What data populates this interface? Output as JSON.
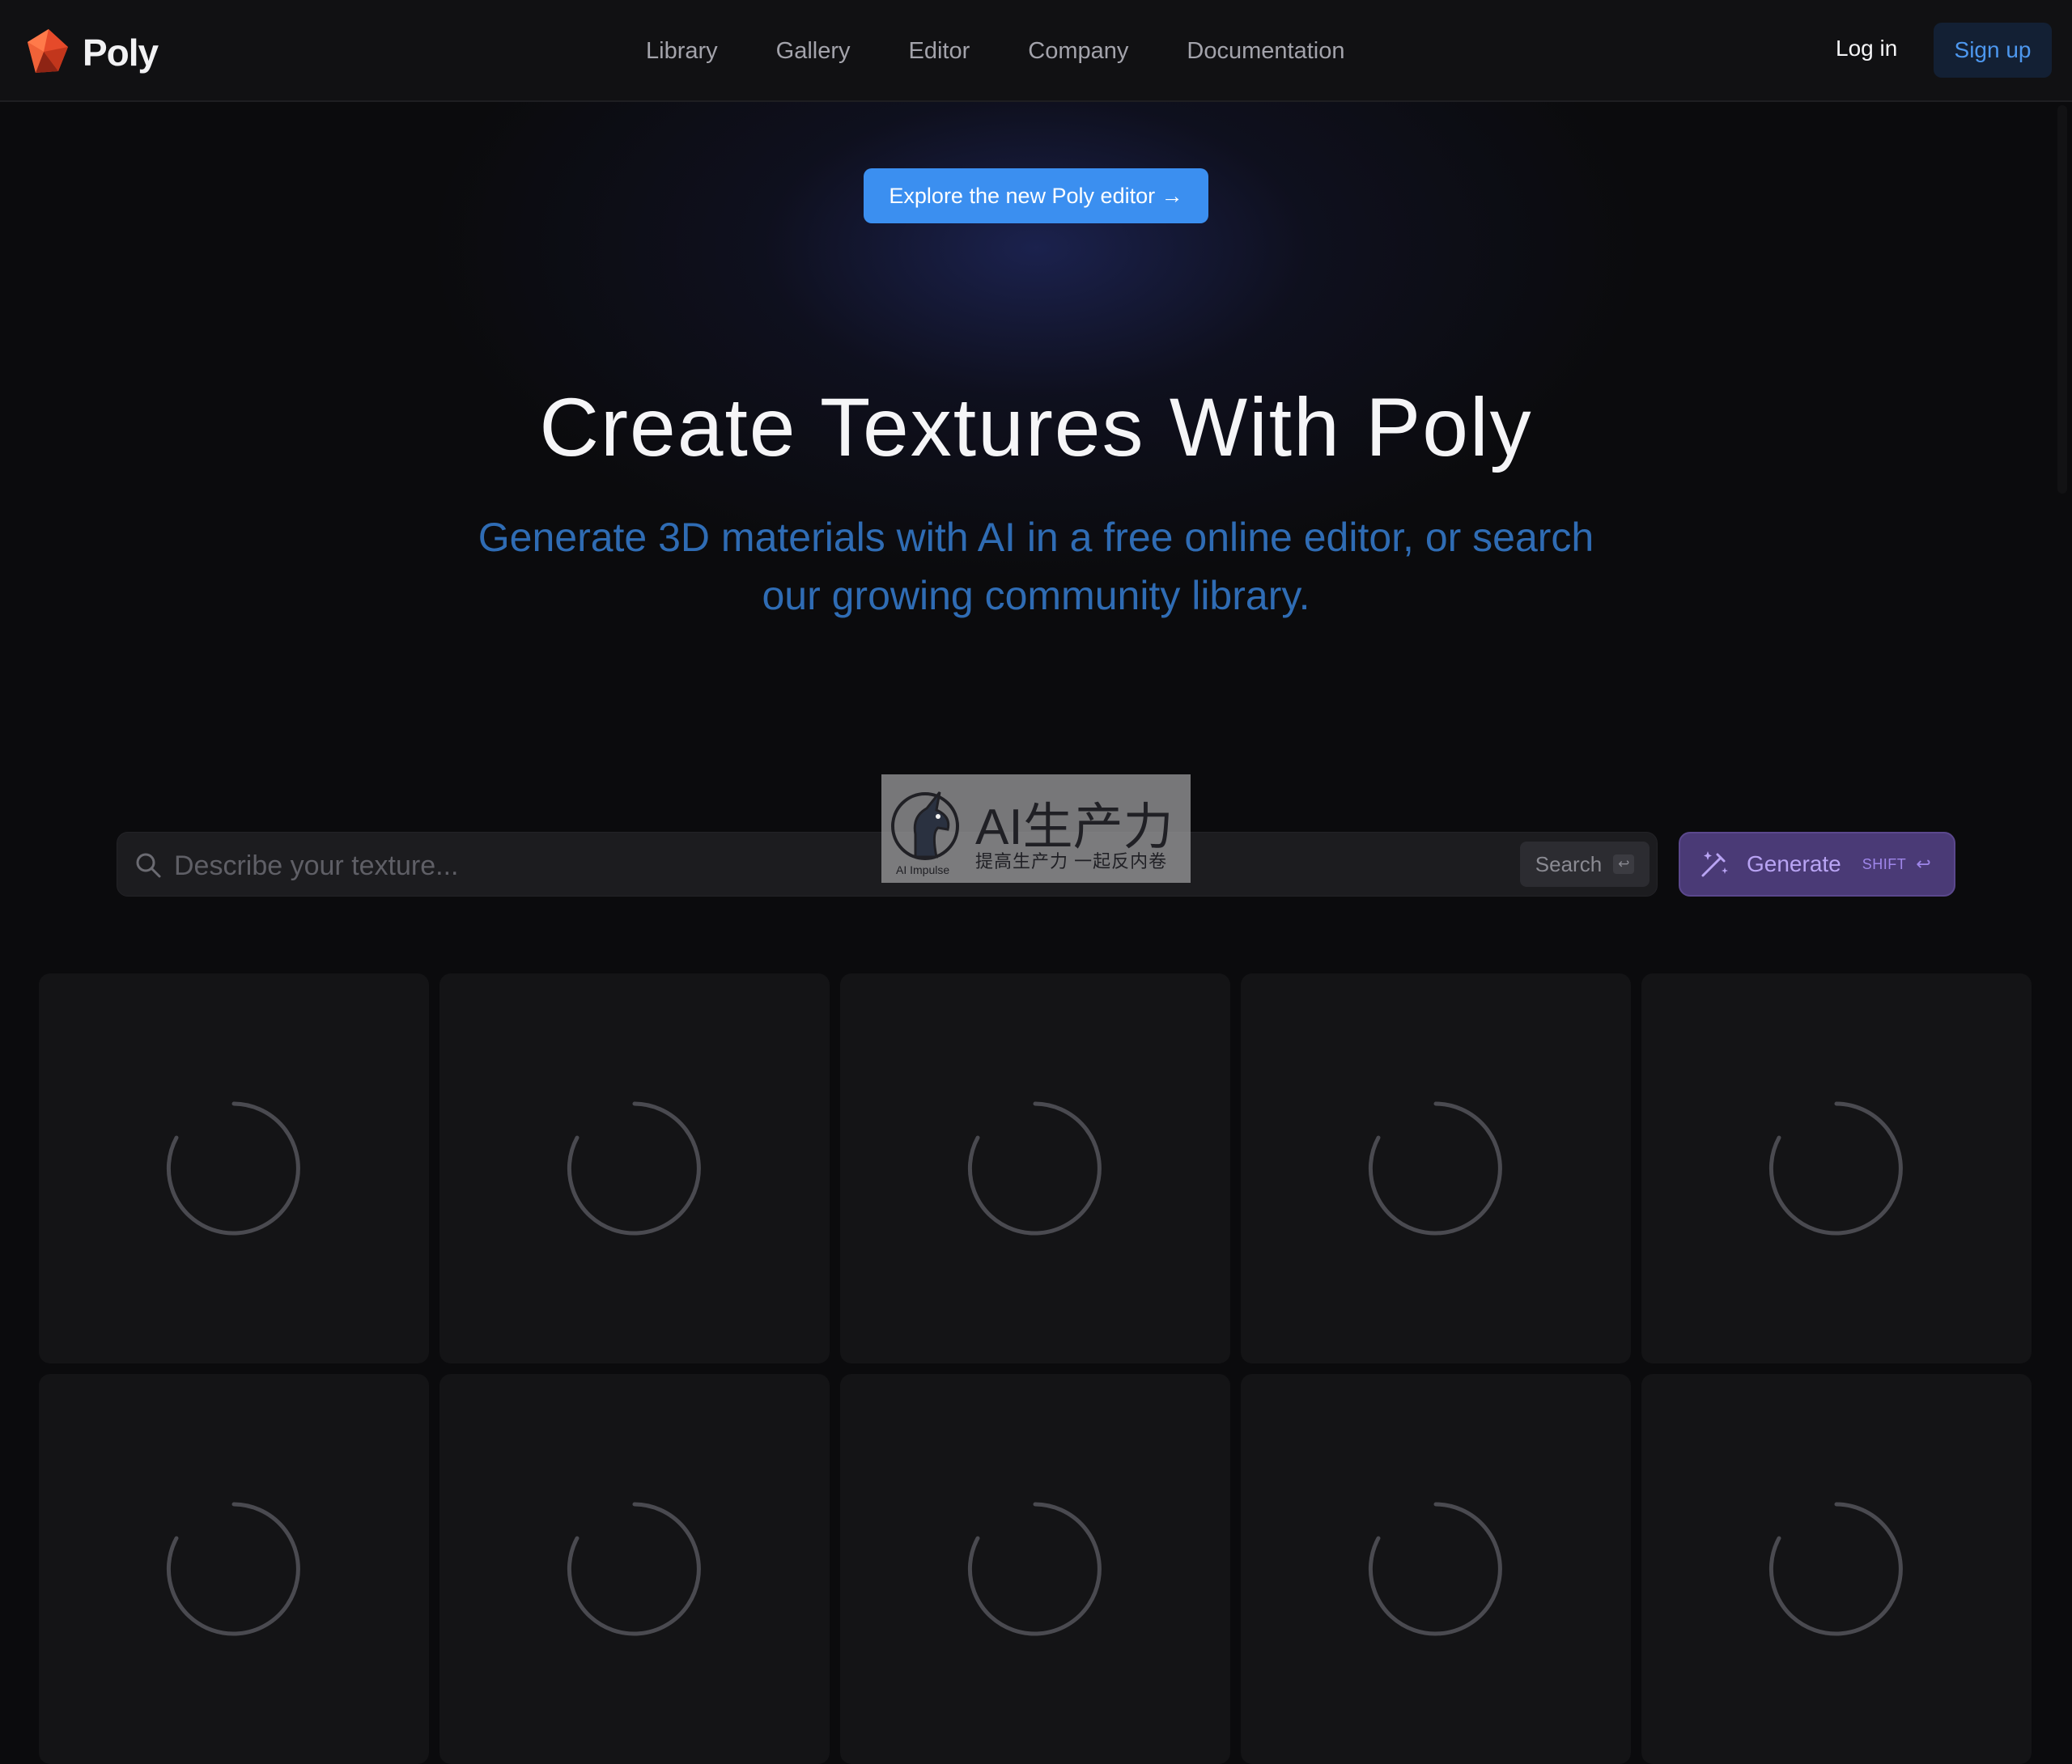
{
  "brand": {
    "name": "Poly"
  },
  "nav": [
    "Library",
    "Gallery",
    "Editor",
    "Company",
    "Documentation"
  ],
  "auth": {
    "login": "Log in",
    "signup": "Sign up"
  },
  "hero": {
    "cta": "Explore the new Poly editor →",
    "title": "Create Textures With Poly",
    "subtitle_line1": "Generate 3D materials with AI in a free online editor, or search",
    "subtitle_line2": "our growing community library."
  },
  "search": {
    "placeholder": "Describe your texture...",
    "value": "",
    "button": "Search",
    "enter_key": "↩"
  },
  "generate": {
    "label": "Generate",
    "shortcut": "SHIFT",
    "enter_key": "↩"
  },
  "watermark": {
    "title": "AI生产力",
    "subtitle": "提高生产力 一起反内卷",
    "brand": "AI Impulse"
  },
  "cards_loading": 10,
  "colors": {
    "accent_blue": "#3b8ff0",
    "subtitle_blue": "#2f6cb4",
    "generate_purple": "#4a3a76",
    "background": "#0b0b0d"
  }
}
